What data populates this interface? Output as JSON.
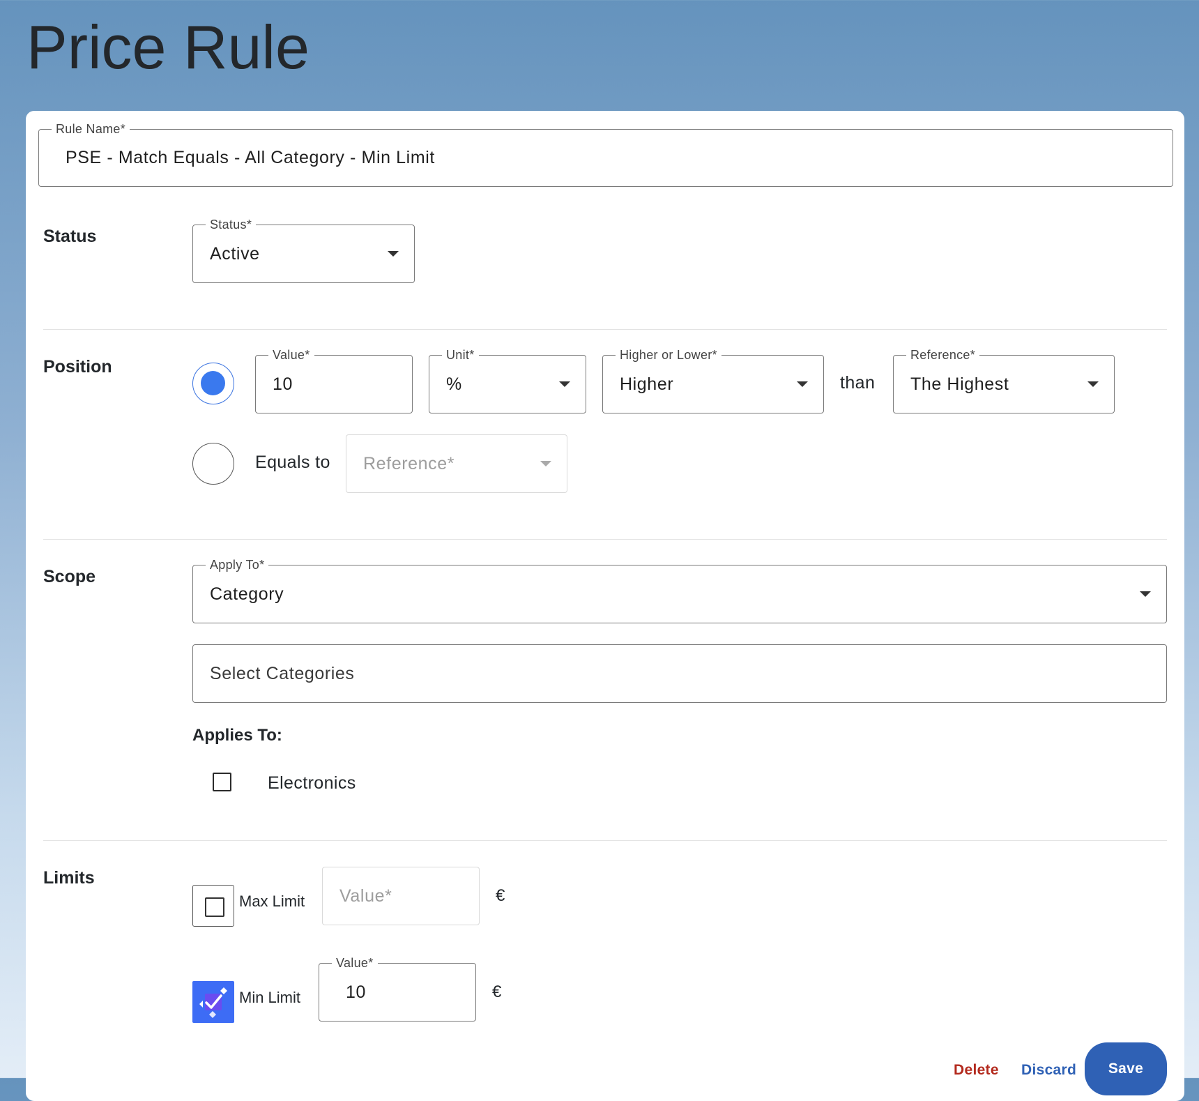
{
  "page": {
    "title": "Price Rule"
  },
  "rule_name": {
    "label": "Rule Name*",
    "value": "PSE - Match Equals - All Category - Min Limit"
  },
  "status_section": {
    "heading": "Status",
    "field": {
      "label": "Status*",
      "value": "Active"
    }
  },
  "position_section": {
    "heading": "Position",
    "option1": {
      "selected": true,
      "value": {
        "label": "Value*",
        "value": "10"
      },
      "unit": {
        "label": "Unit*",
        "value": "%"
      },
      "direction": {
        "label": "Higher or Lower*",
        "value": "Higher"
      },
      "than": "than",
      "reference": {
        "label": "Reference*",
        "value": "The Highest"
      }
    },
    "option2": {
      "selected": false,
      "label": "Equals to",
      "reference_placeholder": "Reference*"
    }
  },
  "scope_section": {
    "heading": "Scope",
    "apply_to": {
      "label": "Apply To*",
      "value": "Category"
    },
    "categories_placeholder": "Select Categories",
    "applies_to_heading": "Applies To:",
    "items": [
      {
        "label": "Electronics",
        "checked": false
      }
    ]
  },
  "limits_section": {
    "heading": "Limits",
    "max": {
      "label": "Max Limit",
      "checked": false,
      "value_placeholder": "Value*",
      "currency": "€"
    },
    "min": {
      "label": "Min Limit",
      "checked": true,
      "value_label": "Value*",
      "value": "10",
      "currency": "€"
    }
  },
  "actions": {
    "delete": "Delete",
    "discard": "Discard",
    "save": "Save"
  },
  "colors": {
    "accent": "#3a79ee",
    "save_bg": "#2f61b5",
    "delete": "#b32a1e",
    "discard": "#2f61b5"
  }
}
